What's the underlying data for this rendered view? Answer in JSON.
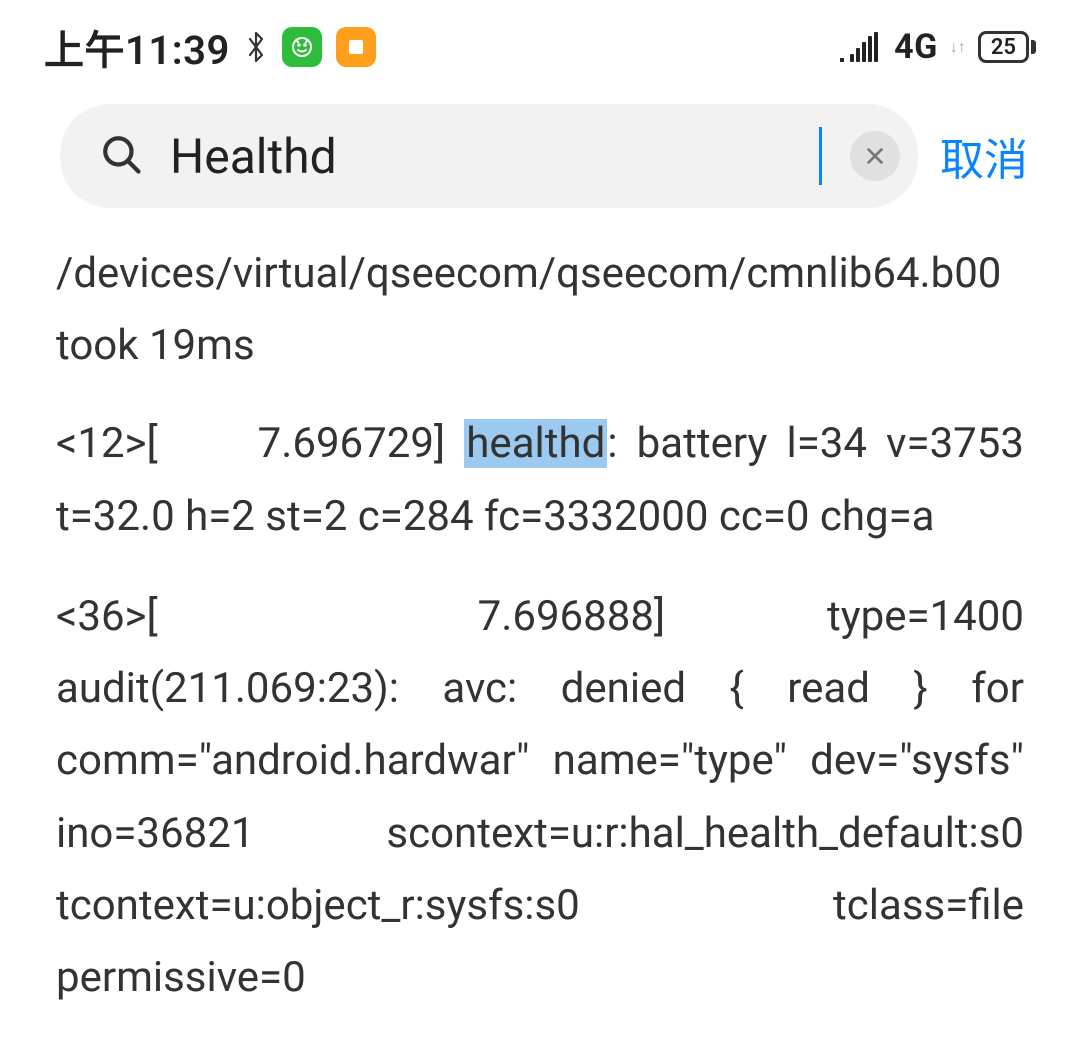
{
  "statusbar": {
    "time": "上午11:39",
    "network": "4G",
    "battery": "25"
  },
  "search": {
    "query": "Healthd",
    "cancel_label": "取消"
  },
  "highlight": "healthd",
  "log": {
    "entry1": "/devices/virtual/qseecom/qseecom/cmnlib64.b00 took 19ms",
    "entry2_pre": "<12>[",
    "entry2_ts": "7.696729] ",
    "entry2_post": ": battery l=34 v=3753 t=32.0 h=2 st=2 c=284 fc=3332000 cc=0 chg=a",
    "entry3_pre": "<36>[",
    "entry3_ts": "7.696888]",
    "entry3_post": " type=1400 audit(211.069:23): avc: denied { read } for comm=\"android.hardwar\" name=\"type\" dev=\"sysfs\" ino=36821 scontext=u:r:hal_health_default:s0 tcontext=u:object_r:sysfs:s0 tclass=file permissive=0"
  }
}
